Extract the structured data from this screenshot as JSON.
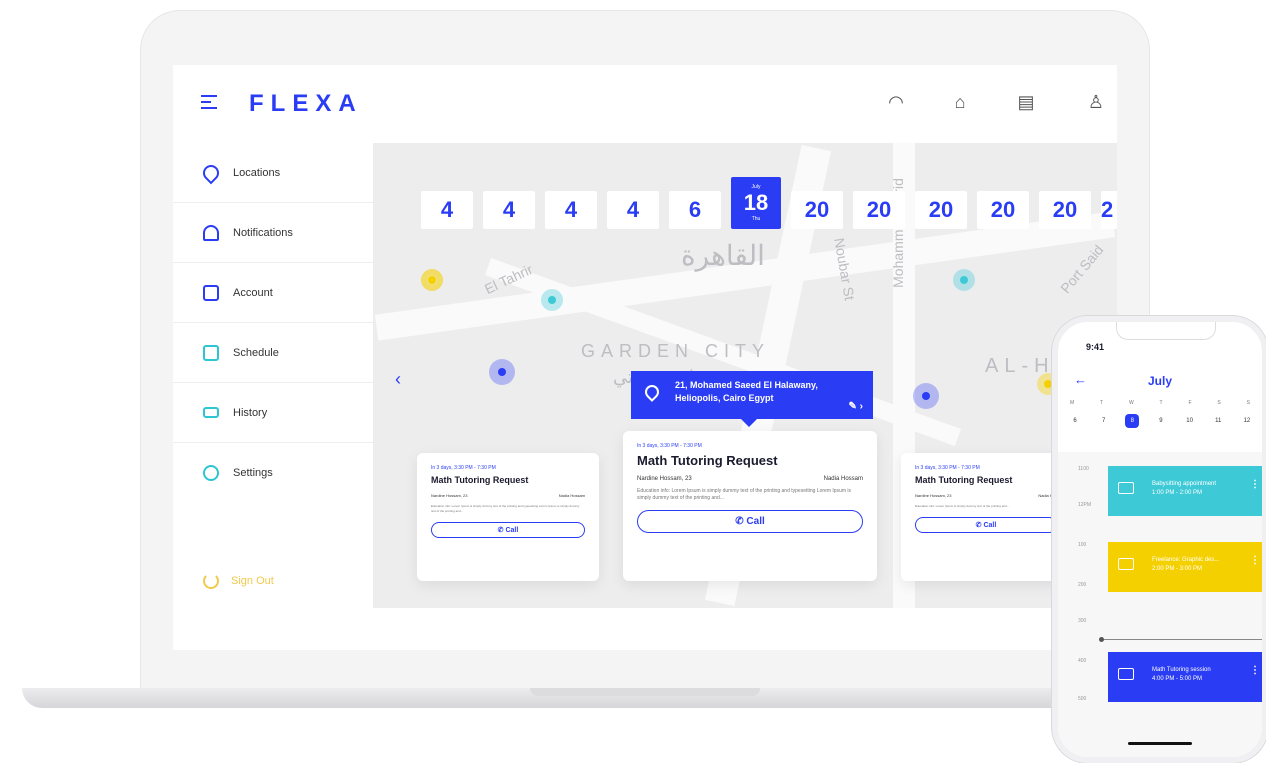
{
  "app": {
    "logo": "FLEXA"
  },
  "header": {
    "icons": [
      "support-icon",
      "home-icon",
      "messages-icon",
      "user-icon"
    ]
  },
  "sidebar": {
    "items": [
      {
        "label": "Locations",
        "icon": "location-icon"
      },
      {
        "label": "Notifications",
        "icon": "bell-icon"
      },
      {
        "label": "Account",
        "icon": "wallet-icon"
      },
      {
        "label": "Schedule",
        "icon": "calendar-icon"
      },
      {
        "label": "History",
        "icon": "history-icon"
      },
      {
        "label": "Settings",
        "icon": "gear-icon"
      }
    ],
    "signout": "Sign Out"
  },
  "map": {
    "dates": [
      "4",
      "4",
      "4",
      "4",
      "6",
      "18",
      "20",
      "20",
      "20",
      "20",
      "20",
      "2"
    ],
    "selected_month": "July",
    "selected_day": "Thu",
    "labels": {
      "cairo": "القاهرة",
      "garden_city": "GARDEN CITY",
      "garden_city_ar": "جاردن سيتي",
      "tahrir": "El Tahrir",
      "al": "AL-H",
      "noubar": "Noubar St",
      "mohammed": "Mohammed Farid",
      "port_said": "Port Said"
    },
    "popup": {
      "line1": "21, Mohamed Saeed El Halawany,",
      "line2": "Heliopolis, Cairo Egypt"
    }
  },
  "cards": [
    {
      "meta": "In 3 days, 3:30 PM - 7:30 PM",
      "title": "Math Tutoring Request",
      "person1": "Nardine Hossam, 23",
      "person2": "Nadia Hossam",
      "desc": "Education info: Lorem Ipsum is simply dummy text of the printing and typesetting Lorem Ipsum is simply dummy text of the printing and...",
      "call": "Call"
    },
    {
      "meta": "In 3 days, 3:30 PM - 7:30 PM",
      "title": "Math Tutoring Request",
      "person1": "Nardine Hossam, 23",
      "person2": "Nadia Hossam",
      "desc": "Education info: Lorem Ipsum is simply dummy text of the printing and typesetting Lorem Ipsum is simply dummy text of the printing and...",
      "call": "Call"
    },
    {
      "meta": "In 3 days, 3:30 PM - 7:30 PM",
      "title": "Math Tutoring Request",
      "person1": "Nardine Hossam, 23",
      "person2": "Nadia Hos",
      "desc": "Education info: Lorem Ipsum is simply dummy text of the printing and...",
      "call": "Call"
    }
  ],
  "phone": {
    "time": "9:41",
    "month": "July",
    "weekdays": [
      "M",
      "T",
      "W",
      "T",
      "F",
      "S",
      "S"
    ],
    "days": [
      "6",
      "7",
      "8",
      "9",
      "10",
      "11",
      "12"
    ],
    "hours": [
      "1100",
      "12PM",
      "100",
      "200",
      "300",
      "400",
      "500"
    ],
    "events": [
      {
        "title": "Babysitting appointment",
        "time": "1:00 PM - 2:00 PM",
        "color": "#3ec9d6"
      },
      {
        "title": "Freelance: Graphic des...",
        "time": "2:00 PM - 3:00 PM",
        "color": "#f5d000"
      },
      {
        "title": "Math Tutoring session",
        "time": "4:00 PM - 5:00 PM",
        "color": "#2a3df5"
      }
    ]
  }
}
